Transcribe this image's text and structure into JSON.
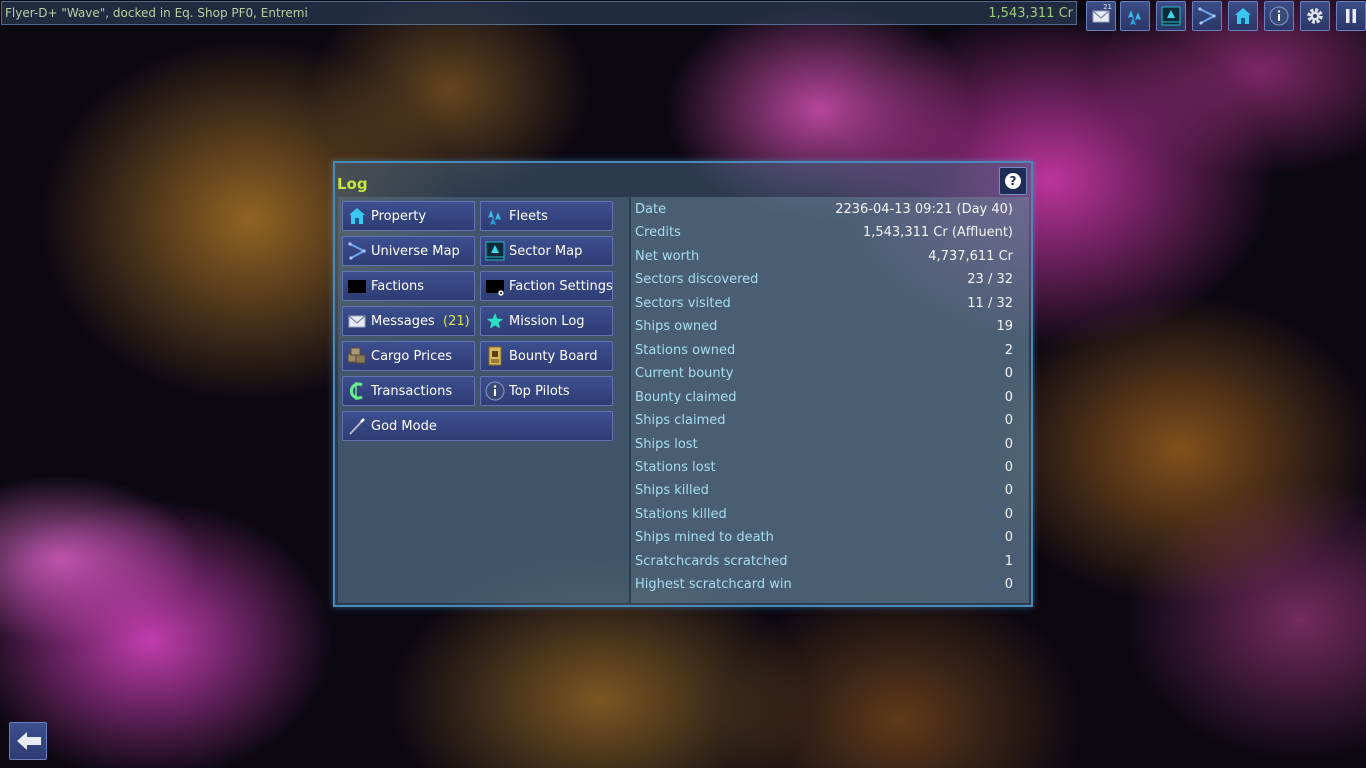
{
  "status_bar": {
    "location": "Flyer-D+ \"Wave\", docked in Eq. Shop PF0, Entremi",
    "credits": "1,543,311 Cr"
  },
  "toolbar": {
    "messages_badge": "21",
    "icons": [
      "messages-icon",
      "fleets-icon",
      "sector-map-icon",
      "universe-map-icon",
      "property-icon",
      "info-icon",
      "settings-icon",
      "pause-icon"
    ]
  },
  "dialog": {
    "title": "Log",
    "buttons": {
      "property": "Property",
      "fleets": "Fleets",
      "universe_map": "Universe Map",
      "sector_map": "Sector Map",
      "factions": "Factions",
      "faction_settings": "Faction Settings",
      "messages": "Messages",
      "messages_count": "(21)",
      "mission_log": "Mission Log",
      "cargo_prices": "Cargo Prices",
      "bounty_board": "Bounty Board",
      "transactions": "Transactions",
      "top_pilots": "Top Pilots",
      "god_mode": "God Mode"
    },
    "stats": [
      {
        "label": "Date",
        "value": "2236-04-13 09:21 (Day 40)"
      },
      {
        "label": "Credits",
        "value": "1,543,311 Cr (Affluent)"
      },
      {
        "label": "Net worth",
        "value": "4,737,611 Cr"
      },
      {
        "label": "Sectors discovered",
        "value": "23 / 32"
      },
      {
        "label": "Sectors visited",
        "value": "11 / 32"
      },
      {
        "label": "Ships owned",
        "value": "19"
      },
      {
        "label": "Stations owned",
        "value": "2"
      },
      {
        "label": "Current bounty",
        "value": "0"
      },
      {
        "label": "Bounty claimed",
        "value": "0"
      },
      {
        "label": "Ships claimed",
        "value": "0"
      },
      {
        "label": "Ships lost",
        "value": "0"
      },
      {
        "label": "Stations lost",
        "value": "0"
      },
      {
        "label": "Ships killed",
        "value": "0"
      },
      {
        "label": "Stations killed",
        "value": "0"
      },
      {
        "label": "Ships mined to death",
        "value": "0"
      },
      {
        "label": "Scratchcards scratched",
        "value": "1"
      },
      {
        "label": "Highest scratchcard win",
        "value": "0"
      }
    ]
  },
  "colors": {
    "accent_title": "#c6e93c",
    "stat_label": "#a8dcf0",
    "button_bg": "#3d4f8f",
    "credits": "#9ecb7a"
  }
}
